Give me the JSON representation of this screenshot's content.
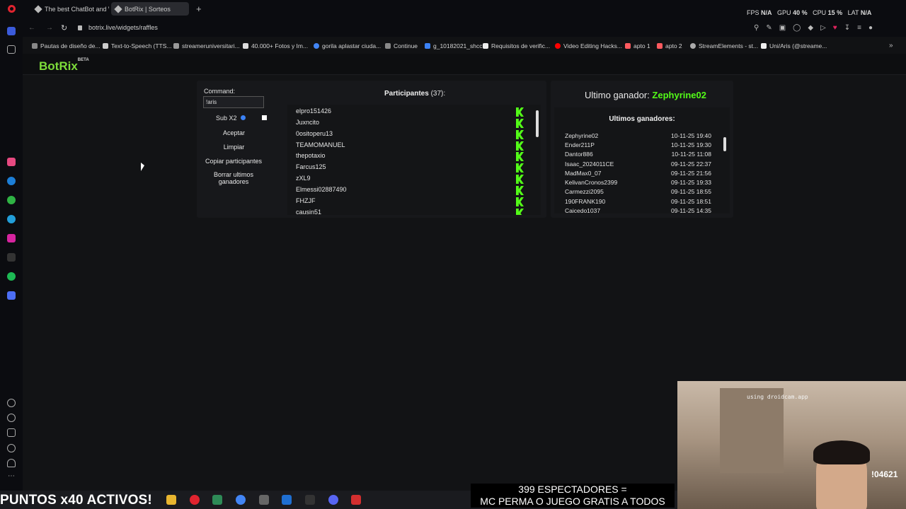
{
  "tabs": [
    {
      "label": "The best ChatBot and Wi"
    },
    {
      "label": "BotRix | Sorteos"
    }
  ],
  "perf": {
    "fps_label": "FPS",
    "fps": "N/A",
    "gpu_label": "GPU",
    "gpu": "40 %",
    "cpu_label": "CPU",
    "cpu": "15 %",
    "lat_label": "LAT",
    "lat": "N/A"
  },
  "address": {
    "url": "botrix.live/widgets/raffles"
  },
  "bookmarks": [
    "Pautas de diseño de...",
    "Text-to-Speech (TTS...",
    "streameruniversitari...",
    "40.000+ Fotos y Im...",
    "gorila aplastar ciuda...",
    "Continue",
    "g_10182021_shcc",
    "Requisitos de verific...",
    "Video Editing Hacks...",
    "apto 1",
    "apto 2",
    "StreamElements - st...",
    "Uni/Aris (@streame..."
  ],
  "logo": {
    "name": "BotRix",
    "tag": "BETA"
  },
  "controls": {
    "command_label": "Command:",
    "command_value": "!aris",
    "sub_label": "Sub X2",
    "accept": "Aceptar",
    "clear": "Limpiar",
    "copy": "Copiar participantes",
    "delete_winners": "Borrar ultimos ganadores"
  },
  "participants": {
    "title": "Participantes",
    "count": "(37):",
    "list": [
      "elpro151426",
      "Juxncito",
      "0ositoperu13",
      "TEAMOMANUEL",
      "thepotaxio",
      "Farcus125",
      "zXL9",
      "Elmessi02887490",
      "FHZJF",
      "causin51"
    ]
  },
  "winner": {
    "label": "Ultimo ganador:",
    "name": "Zephyrine02"
  },
  "last_winners": {
    "title": "Ultimos ganadores:",
    "rows": [
      {
        "name": "Zephyrine02",
        "date": "10-11-25 19:40"
      },
      {
        "name": "Ender211P",
        "date": "10-11-25 19:30"
      },
      {
        "name": "Dantor886",
        "date": "10-11-25 11:08"
      },
      {
        "name": "Isaac_2024011CE",
        "date": "09-11-25 22:37"
      },
      {
        "name": "MadMax0_07",
        "date": "09-11-25 21:56"
      },
      {
        "name": "KelivanCronos2399",
        "date": "09-11-25 19:33"
      },
      {
        "name": "Carmezzi2095",
        "date": "09-11-25 18:55"
      },
      {
        "name": "190FRANK190",
        "date": "09-11-25 18:51"
      },
      {
        "name": "Caicedo1037",
        "date": "09-11-25 14:35"
      }
    ]
  },
  "overlay": {
    "left_text": "PUNTOS x40 ACTIVOS!",
    "right_line1": "399 ESPECTADORES =",
    "right_line2": "MC PERMA O JUEGO GRATIS A TODOS",
    "cam_text": "using droidcam.app",
    "cam_badge": "!04621"
  },
  "colors": {
    "accent_green": "#53fc18",
    "winner_green": "#7ddc3a",
    "brand_red": "#e0242f"
  }
}
